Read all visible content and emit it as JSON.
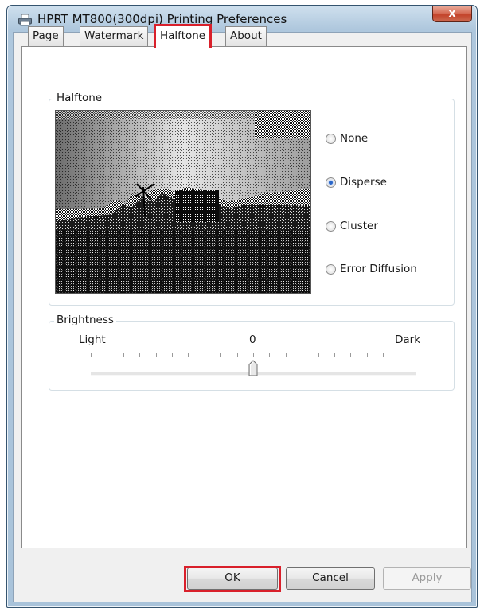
{
  "window": {
    "title": "HPRT MT800(300dpi) Printing Preferences",
    "close_glyph": "x",
    "icon": "printer-icon"
  },
  "tabs": [
    {
      "label": "Page",
      "active": false
    },
    {
      "label": "Watermark",
      "active": false
    },
    {
      "label": "Halftone",
      "active": true
    },
    {
      "label": "About",
      "active": false
    }
  ],
  "halftone": {
    "group_label": "Halftone",
    "options": [
      {
        "label": "None",
        "selected": false
      },
      {
        "label": "Disperse",
        "selected": true
      },
      {
        "label": "Cluster",
        "selected": false
      },
      {
        "label": "Error Diffusion",
        "selected": false
      }
    ]
  },
  "brightness": {
    "group_label": "Brightness",
    "min_label": "Light",
    "value_label": "0",
    "max_label": "Dark",
    "value_fraction": 0.5
  },
  "buttons": {
    "ok": "OK",
    "cancel": "Cancel",
    "apply": "Apply"
  },
  "colors": {
    "highlight": "#d9202b",
    "close": "#c3432a",
    "radio_dot": "#2a66c8"
  }
}
